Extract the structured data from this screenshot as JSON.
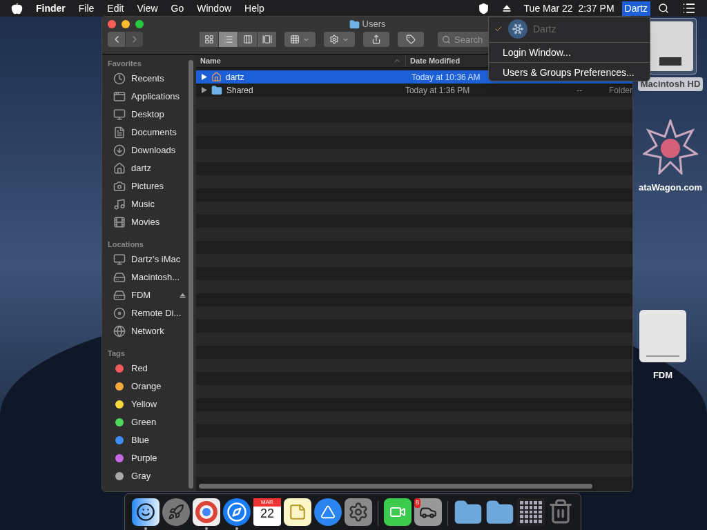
{
  "menubar": {
    "items": [
      {
        "label": "Finder",
        "kind": "app"
      },
      {
        "label": "File",
        "kind": "menu"
      },
      {
        "label": "Edit",
        "kind": "menu"
      },
      {
        "label": "View",
        "kind": "menu"
      },
      {
        "label": "Go",
        "kind": "menu"
      },
      {
        "label": "Window",
        "kind": "menu"
      },
      {
        "label": "Help",
        "kind": "menu"
      }
    ],
    "clock": "Tue Mar 22  2:37 PM",
    "user": {
      "label": "Dartz",
      "selected": true
    }
  },
  "user_menu": {
    "header": {
      "label": "Dartz",
      "checked": true,
      "disabled": true
    },
    "items": [
      "Login Window...",
      "Users & Groups Preferences..."
    ]
  },
  "window": {
    "title": "Users",
    "search": {
      "placeholder": "Search"
    },
    "views": [
      {
        "kind": "icons",
        "selected": false
      },
      {
        "kind": "list",
        "selected": true
      },
      {
        "kind": "columns",
        "selected": false
      },
      {
        "kind": "gallery",
        "selected": false
      }
    ]
  },
  "sidebar": {
    "sections": [
      {
        "title": "Favorites",
        "items": [
          {
            "label": "Recents",
            "kind": "recents"
          },
          {
            "label": "Applications",
            "kind": "apps"
          },
          {
            "label": "Desktop",
            "kind": "desktop"
          },
          {
            "label": "Documents",
            "kind": "documents"
          },
          {
            "label": "Downloads",
            "kind": "downloads"
          },
          {
            "label": "dartz",
            "kind": "home"
          },
          {
            "label": "Pictures",
            "kind": "pictures"
          },
          {
            "label": "Music",
            "kind": "music"
          },
          {
            "label": "Movies",
            "kind": "movies"
          }
        ]
      },
      {
        "title": "Locations",
        "items": [
          {
            "label": "Dartz’s iMac",
            "kind": "computer"
          },
          {
            "label": "Macintosh...",
            "kind": "disk"
          },
          {
            "label": "FDM",
            "kind": "drive",
            "eject": true
          },
          {
            "label": "Remote Di...",
            "kind": "disc"
          },
          {
            "label": "Network",
            "kind": "network"
          }
        ]
      },
      {
        "title": "Tags",
        "items": [
          {
            "label": "Red",
            "kind": "tag",
            "color": "#f05a5a"
          },
          {
            "label": "Orange",
            "kind": "tag",
            "color": "#f5a93c"
          },
          {
            "label": "Yellow",
            "kind": "tag",
            "color": "#f6d83a"
          },
          {
            "label": "Green",
            "kind": "tag",
            "color": "#4fd75a"
          },
          {
            "label": "Blue",
            "kind": "tag",
            "color": "#3c8ef5"
          },
          {
            "label": "Purple",
            "kind": "tag",
            "color": "#c86ae8"
          },
          {
            "label": "Gray",
            "kind": "tag",
            "color": "#a8a8a8"
          }
        ]
      }
    ]
  },
  "table": {
    "columns": [
      {
        "label": "Name",
        "sorted": true
      },
      {
        "label": "Date Modified",
        "sorted": false
      }
    ],
    "rows": [
      {
        "name": "dartz",
        "kind": "home",
        "date": "Today at 10:36 AM",
        "selected": true
      },
      {
        "name": "Shared",
        "kind": "folder",
        "date": "Today at 1:36 PM",
        "column_3": "--",
        "column_4": "Folder",
        "selected": false
      }
    ]
  },
  "desktop_icons": [
    {
      "label": "Macintosh HD",
      "kind": "disk",
      "selected": true
    },
    {
      "label": "ataWagon.com",
      "kind": "logo",
      "selected": false
    },
    {
      "label": "FDM",
      "kind": "drive",
      "selected": false
    }
  ],
  "dock": [
    {
      "kind": "finder",
      "running": true
    },
    {
      "kind": "launchpad",
      "running": false
    },
    {
      "kind": "chrome",
      "running": true
    },
    {
      "kind": "safari",
      "running": true
    },
    {
      "kind": "calendar",
      "running": false,
      "month": "MAR",
      "day": "22"
    },
    {
      "kind": "notes",
      "running": false
    },
    {
      "kind": "appstore",
      "running": false
    },
    {
      "kind": "prefs",
      "running": false
    },
    {
      "kind": "separator"
    },
    {
      "kind": "facetime",
      "running": false
    },
    {
      "kind": "game",
      "running": false,
      "badge": "8"
    },
    {
      "kind": "separator"
    },
    {
      "kind": "folder-apps",
      "running": false
    },
    {
      "kind": "folder-downloads",
      "running": false
    },
    {
      "kind": "grid",
      "running": false
    },
    {
      "kind": "trash",
      "running": false
    }
  ]
}
